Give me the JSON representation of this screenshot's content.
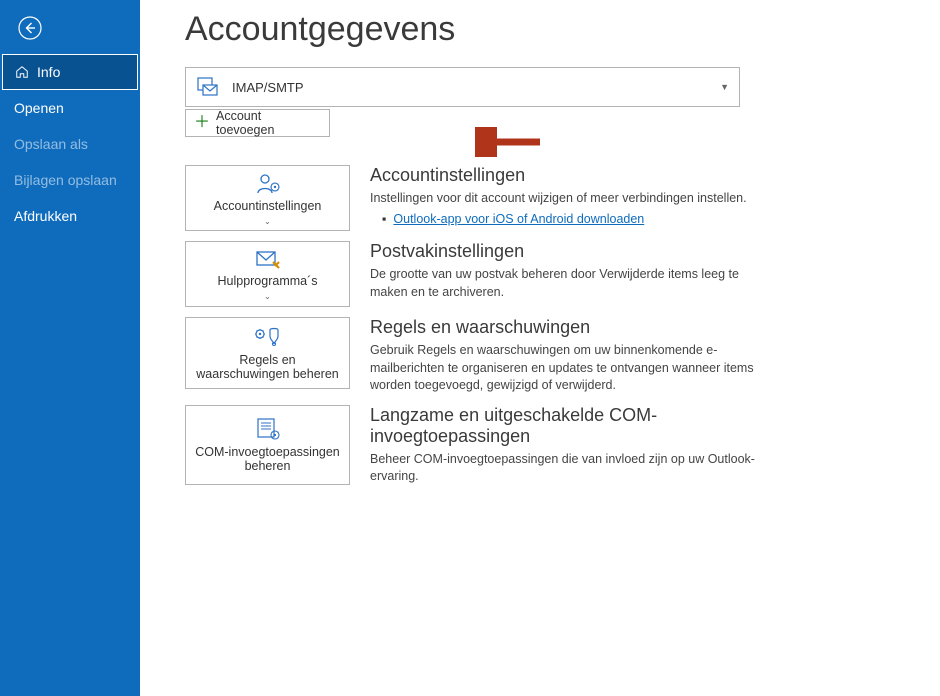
{
  "sidebar": {
    "items": [
      {
        "label": "Info"
      },
      {
        "label": "Openen"
      },
      {
        "label": "Opslaan als"
      },
      {
        "label": "Bijlagen opslaan"
      },
      {
        "label": "Afdrukken"
      }
    ]
  },
  "page": {
    "title": "Accountgegevens"
  },
  "account_select": {
    "protocol": "IMAP/SMTP"
  },
  "buttons": {
    "add_account": "Account toevoegen"
  },
  "sections": {
    "account_settings": {
      "card_label": "Accountinstellingen",
      "title": "Accountinstellingen",
      "desc": "Instellingen voor dit account wijzigen of meer verbindingen instellen.",
      "link": "Outlook-app voor iOS of Android downloaden"
    },
    "mailbox_tools": {
      "card_label": "Hulpprogramma´s",
      "title": "Postvakinstellingen",
      "desc": "De grootte van uw postvak beheren door Verwijderde items leeg te maken en te archiveren."
    },
    "rules": {
      "card_label": "Regels en waarschuwingen beheren",
      "title": "Regels en waarschuwingen",
      "desc": "Gebruik Regels en waarschuwingen om uw binnenkomende e-mailberichten te organiseren en updates te ontvangen wanneer items worden toegevoegd, gewijzigd of verwijderd."
    },
    "com_addins": {
      "card_label": "COM-invoegtoepassingen beheren",
      "title": "Langzame en uitgeschakelde COM-invoegtoepassingen",
      "desc": "Beheer COM-invoegtoepassingen die van invloed zijn op uw Outlook-ervaring."
    }
  }
}
